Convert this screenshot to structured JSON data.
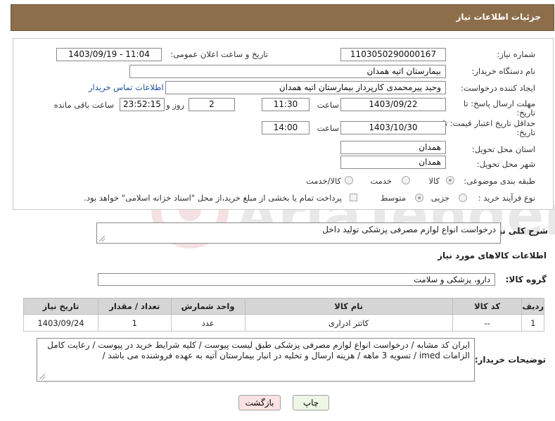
{
  "header": {
    "title": "جزئیات اطلاعات نیاز"
  },
  "form": {
    "need_number_label": "شماره نیاز:",
    "need_number": "1103050290000167",
    "announce_label": "تاریخ و ساعت اعلان عمومی:",
    "announce_value": "1403/09/19 - 11:04",
    "buyer_org_label": "نام دستگاه خریدار:",
    "buyer_org": "بیمارستان اتیه همدان",
    "requester_label": "ایجاد کننده درخواست:",
    "requester": "وحید پیرمحمدی کارپرداز بیمارستان اتیه همدان",
    "contact_link": "اطلاعات تماس خریدار",
    "deadline_label_1": "مهلت ارسال پاسخ: تا",
    "deadline_label_2": "تاریخ:",
    "deadline_date": "1403/09/22",
    "time_label": "ساعت",
    "deadline_time": "11:30",
    "days_value": "2",
    "days_label": "روز و",
    "remaining_time": "23:52:15",
    "remaining_label": "ساعت باقی مانده",
    "price_validity_label_1": "حداقل تاریخ اعتبار قیمت: تا",
    "price_validity_label_2": "تاریخ:",
    "price_validity_date": "1403/10/30",
    "price_validity_time_label": "ساعت",
    "price_validity_time": "14:00",
    "province_label": "استان محل تحویل:",
    "province": "همدان",
    "city_label": "شهر محل تحویل:",
    "city": "همدان",
    "category_label": "طبقه بندی موضوعی:",
    "category_options": [
      "کالا",
      "خدمت",
      "کالا/خدمت"
    ],
    "purchase_type_label": "نوع فرآیند خرید :",
    "purchase_options": [
      "جزیی",
      "متوسط"
    ],
    "payment_note": "پرداخت تمام یا بخشی از مبلغ خرید،از محل \"اسناد خزانه اسلامی\" خواهد بود."
  },
  "description": {
    "label": "شرح کلی نیاز:",
    "value": "درخواست انواع لوازم مصرفی پزشکی تولید داخل"
  },
  "goods_section": {
    "title": "اطلاعات کالاهای مورد نیاز",
    "group_label": "گروه کالا:",
    "group_value": "دارو، پزشکی و سلامت"
  },
  "table": {
    "headers": [
      "ردیف",
      "کد کالا",
      "نام کالا",
      "واحد شمارش",
      "تعداد / مقدار",
      "تاریخ نیاز"
    ],
    "rows": [
      [
        "1",
        "--",
        "کاتتر ادراری",
        "عدد",
        "1",
        "1403/09/24"
      ]
    ]
  },
  "buyer_notes": {
    "label": "توضیحات خریدار:",
    "value": "ایران کد مشابه / درخواست انواع لوازم مصرفی پزشکی طبق لیست پیوست / کلیه شرایط خرید در پیوست / رعایت کامل الزامات imed / تسویه 3 ماهه / هزینه ارسال و تخلیه در انبار بیمارستان آتیه به عهده فروشنده می باشد /"
  },
  "buttons": {
    "print": "چاپ",
    "back": "بازگشت"
  },
  "watermark_text": "AriaTender.net",
  "colors": {
    "header_bg": "#8d6e4a",
    "link": "#1f4e9c",
    "back_button_bg": "#fbe3e3",
    "print_button_bg": "#eef7e6"
  }
}
